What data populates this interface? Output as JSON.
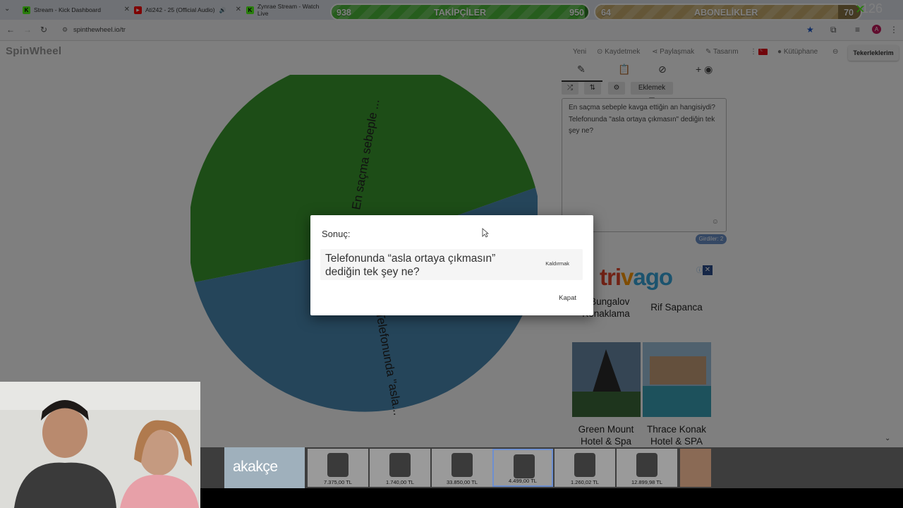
{
  "browser": {
    "tabs": [
      {
        "title": "Stream - Kick Dashboard",
        "icon": "kick-icon"
      },
      {
        "title": "Ati242 - 25 (Official Audio)",
        "icon": "youtube-icon"
      },
      {
        "title": "Zynrae Stream - Watch Live",
        "icon": "kick-icon"
      }
    ],
    "url": "spinthewheel.io/tr"
  },
  "overlay": {
    "followers": {
      "label": "TAKİPÇİLER",
      "current": "938",
      "goal": "950",
      "progress": 0.987,
      "color": "#4cbb3a"
    },
    "subscribers": {
      "label": "ABONELİKLER",
      "current": "64",
      "goal": "70",
      "progress": 0.914,
      "color": "#c8ad6e"
    },
    "viewer_count": "126"
  },
  "site": {
    "logo": "SpinWheel",
    "nav": [
      "Yeni",
      "Kaydetmek",
      "Paylaşmak",
      "Tasarım"
    ],
    "nav_extra": [
      "Kütüphane"
    ],
    "wheels_button": "Tekerleklerim",
    "add_label": "Eklemek",
    "entries": [
      "En saçma sebeple kavga ettiğin an hangisiydi?",
      "Telefonunda \"asla ortaya çıkmasın\" dediğin tek şey ne?"
    ],
    "entries_count": "Girdiler: 2"
  },
  "wheel": {
    "segments": [
      {
        "label": "En saçma sebeple ...",
        "color": "#3a9b2f",
        "share": 0.5
      },
      {
        "label": "Telefonunda \"asla...",
        "color": "#4a8ab5",
        "share": 0.5
      }
    ]
  },
  "dialog": {
    "title": "Sonuç:",
    "result": "Telefonunda “asla ortaya çıkmasın” dediğin tek şey ne?",
    "remove_label": "Kaldırmak",
    "close_label": "Kapat"
  },
  "ad": {
    "brand": "trivago",
    "cards": [
      {
        "name": "s Bungalov Konaklama"
      },
      {
        "name": "Rif Sapanca"
      },
      {
        "name": "Green Mount Hotel & Spa"
      },
      {
        "name": "Thrace Konak Hotel & SPA"
      }
    ]
  },
  "shopping": {
    "brand": "akakçe",
    "products": [
      {
        "price": "7.375,00 TL"
      },
      {
        "price": "1.740,00 TL"
      },
      {
        "price": "33.850,00 TL"
      },
      {
        "price": "4.499,00 TL"
      },
      {
        "price": "1.260,02 TL"
      },
      {
        "price": "12.899,98 TL"
      }
    ]
  }
}
